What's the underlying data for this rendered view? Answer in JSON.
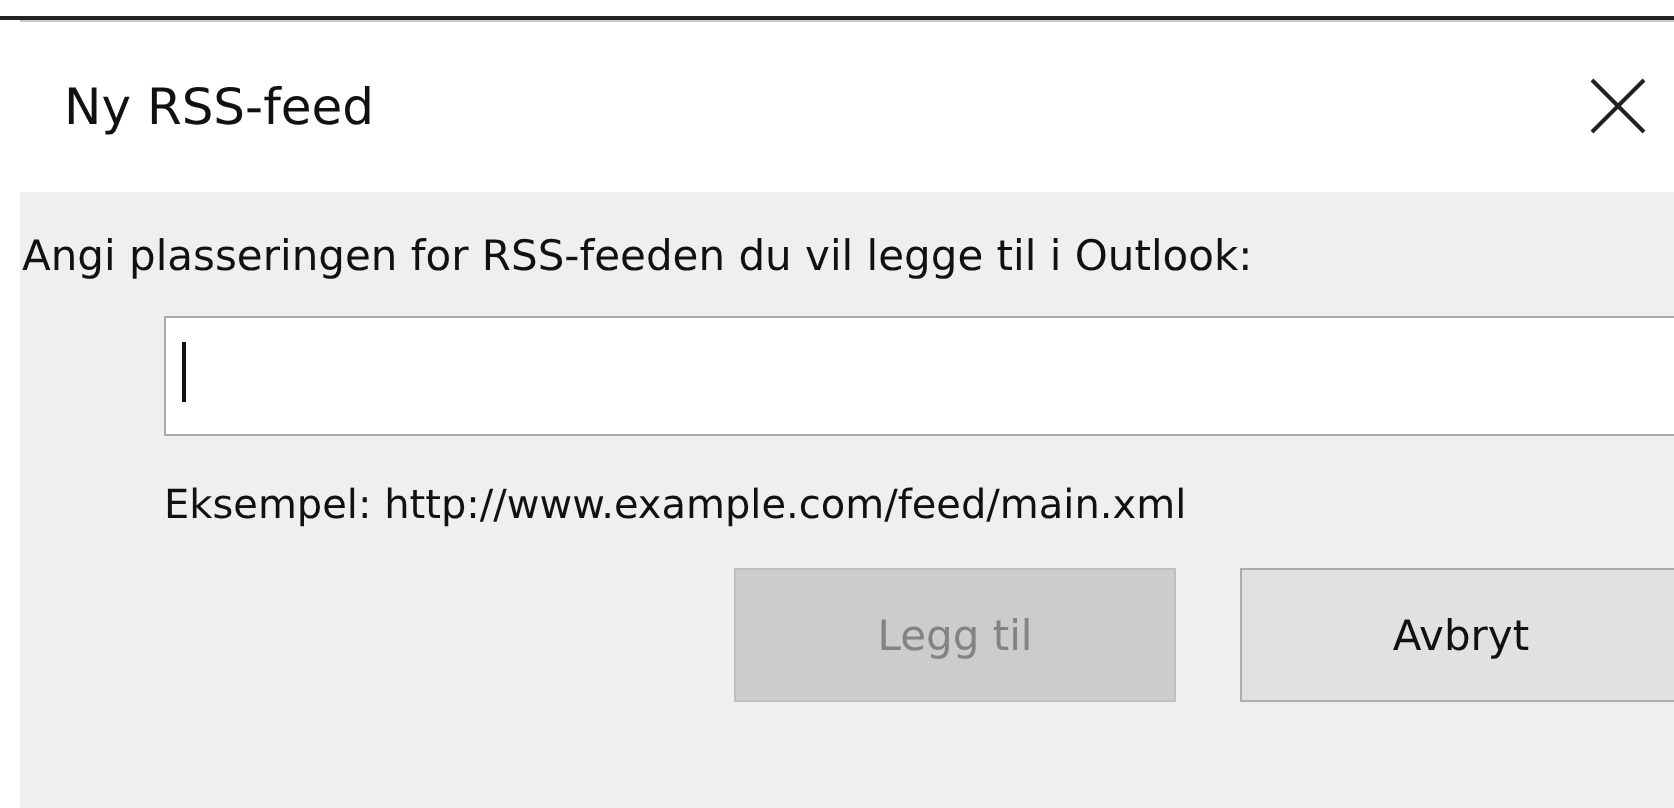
{
  "window": {
    "title": "Ny RSS-feed"
  },
  "prompt": "Angi plasseringen for RSS-feeden du vil legge til i Outlook:",
  "location_field": {
    "focused": true
  },
  "example": "Eksempel: http://www.example.com/feed/main.xml",
  "buttons": [
    {
      "label": "Legg til",
      "disabled": true
    },
    {
      "label": "Avbryt",
      "disabled": false
    }
  ]
}
